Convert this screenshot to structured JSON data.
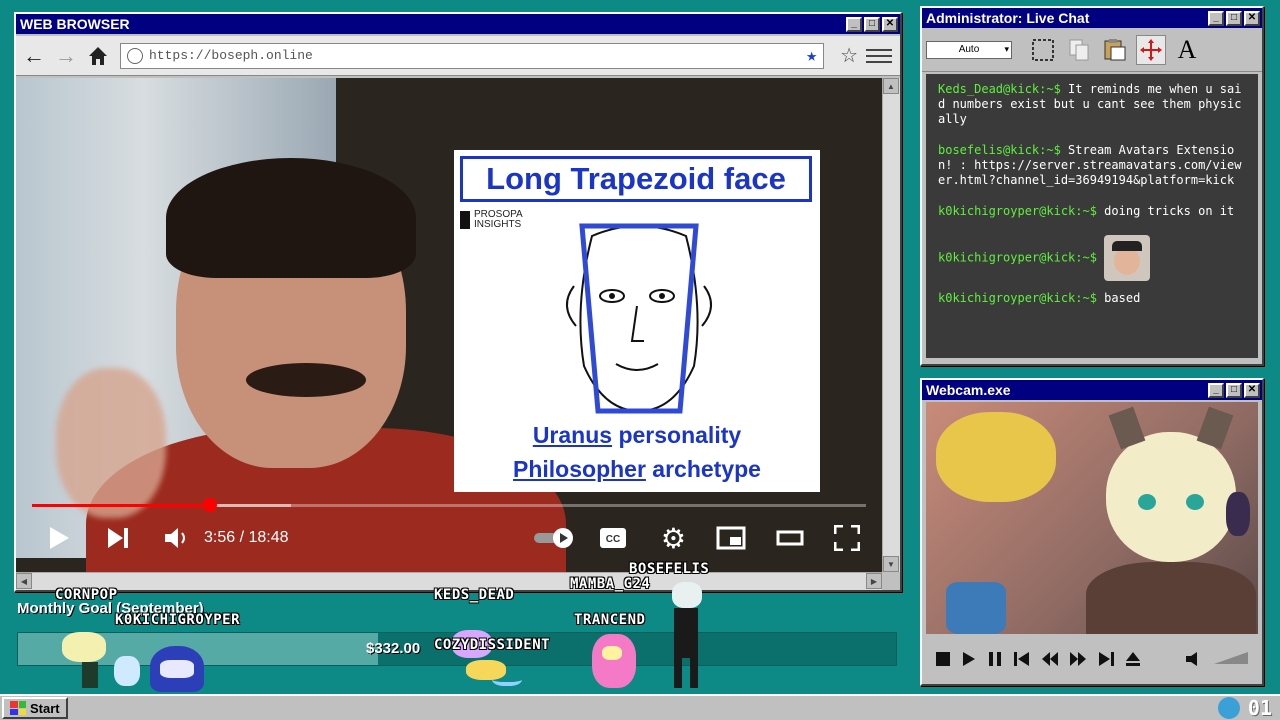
{
  "browser": {
    "title": "WEB BROWSER",
    "url": "https://boseph.online",
    "controls": [
      "_",
      "□",
      "✕"
    ]
  },
  "video": {
    "slide_title": "Long Trapezoid face",
    "logo_top": "PROSOPA",
    "logo_bottom": "INSIGHTS",
    "line1_link": "Uranus",
    "line1_rest": " personality",
    "line2_link": "Philosopher",
    "line2_rest": " archetype",
    "time": "3:56 / 18:48",
    "progress_played": 0.213,
    "progress_buffered": 0.31
  },
  "overlay": {
    "goal_label": "Monthly Goal (September)",
    "goal_amount": "$332.00",
    "goal_progress": 0.41,
    "avatars": [
      "CORNPOP",
      "K0KICHIGROYPER",
      "KEDS_DEAD",
      "MAMBA_G24",
      "BOSEFELIS",
      "COZYDISSIDENT",
      "TRANCEND"
    ]
  },
  "chat": {
    "title": "Administrator: Live Chat",
    "font_select": "Auto",
    "messages": [
      {
        "user": "Keds_Dead@kick:~$",
        "text": " It reminds me when u said numbers exist but u cant see them physically"
      },
      {
        "user": "bosefelis@kick:~$",
        "text": " Stream Avatars Extension! : https://server.streamavatars.com/viewer.html?channel_id=36949194&platform=kick"
      },
      {
        "user": "k0kichigroyper@kick:~$",
        "text": " doing tricks on it"
      },
      {
        "user": "k0kichigroyper@kick:~$",
        "text": ""
      },
      {
        "user": "k0kichigroyper@kick:~$",
        "text": " based"
      }
    ]
  },
  "webcam": {
    "title": "Webcam.exe"
  },
  "taskbar": {
    "start_label": "Start",
    "clock": "01"
  },
  "colors": {
    "desktop": "#0d8a85",
    "titlebar": "#000080",
    "chat_user": "#5ef03c",
    "slide_blue": "#1a35c8"
  }
}
